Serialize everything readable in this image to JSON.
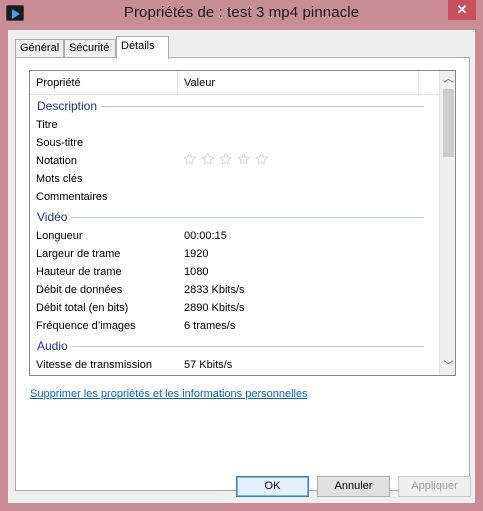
{
  "window": {
    "title": "Propriétés de : test 3 mp4 pinnacle",
    "close_glyph": "✕"
  },
  "tabs": [
    "Général",
    "Sécurité",
    "Détails"
  ],
  "active_tab": "Détails",
  "list": {
    "col_property": "Propriété",
    "col_value": "Valeur",
    "groups": [
      {
        "title": "Description",
        "rows": [
          {
            "key": "Titre",
            "value": ""
          },
          {
            "key": "Sous-titre",
            "value": ""
          },
          {
            "key": "Notation",
            "value": "",
            "rating_stars": 0,
            "rating_max": 5
          },
          {
            "key": "Mots clés",
            "value": ""
          },
          {
            "key": "Commentaires",
            "value": ""
          }
        ]
      },
      {
        "title": "Vidéo",
        "rows": [
          {
            "key": "Longueur",
            "value": "00:00:15"
          },
          {
            "key": "Largeur de trame",
            "value": "1920"
          },
          {
            "key": "Hauteur de trame",
            "value": "1080"
          },
          {
            "key": "Débit de données",
            "value": "2833 Kbits/s"
          },
          {
            "key": "Débit total (en bits)",
            "value": "2890 Kbits/s"
          },
          {
            "key": "Fréquence d’images",
            "value": "6 trames/s"
          }
        ]
      },
      {
        "title": "Audio",
        "rows": [
          {
            "key": "Vitesse de transmission",
            "value": "57 Kbits/s"
          }
        ]
      }
    ],
    "scroll_up_glyph": "︿",
    "scroll_down_glyph": "﹀"
  },
  "link_remove": "Supprimer les propriétés et les informations personnelles",
  "buttons": {
    "ok": "OK",
    "cancel": "Annuler",
    "apply": "Appliquer"
  },
  "colors": {
    "titlebar": "#c98d97",
    "close": "#c7505a",
    "group_text": "#1e3287",
    "link": "#0066cc"
  },
  "icons": {
    "app": "media-player-icon",
    "close": "close-icon",
    "star": "star-outline-icon"
  }
}
